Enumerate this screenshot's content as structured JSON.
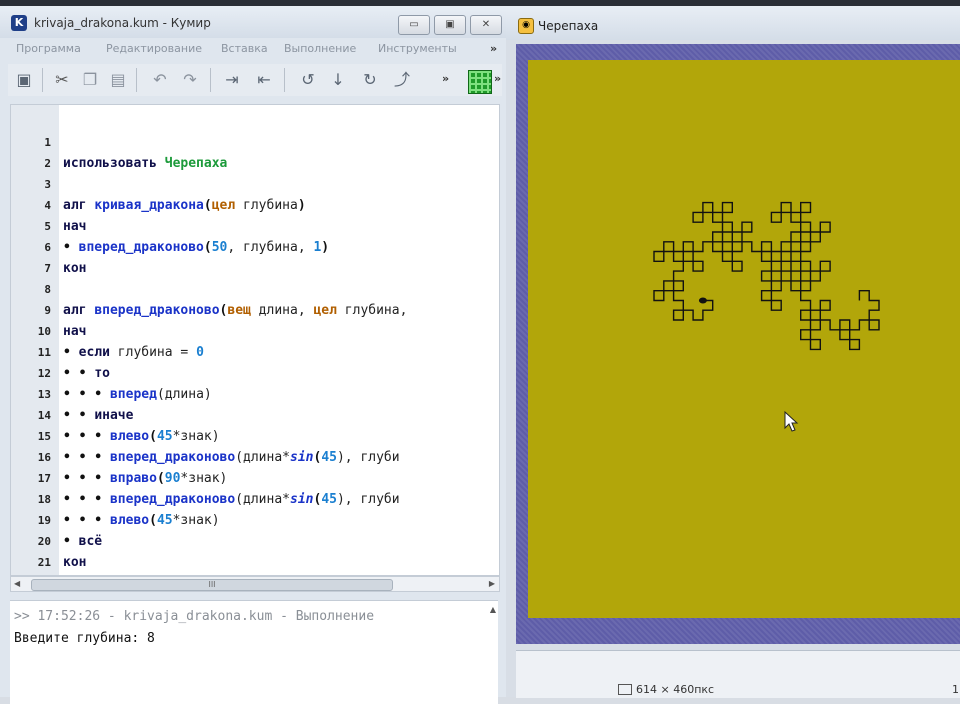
{
  "editor": {
    "title": "krivaja_drakona.kum - Кумир",
    "app_icon_letter": "K",
    "window_buttons": [
      "▭",
      "▣",
      "✕"
    ],
    "menu": [
      "Программа",
      "Редактирование",
      "Вставка",
      "Выполнение",
      "Инструменты"
    ],
    "menu_more": "»",
    "toolbar_more": "»",
    "toolbar_icons": [
      "save-icon",
      "cut-icon",
      "copy-icon",
      "paste-icon",
      "undo-icon",
      "redo-icon",
      "indent-icon",
      "unindent-icon",
      "step-over-icon",
      "step-into-icon",
      "step-out-icon",
      "run-to-end-icon",
      "grid-icon"
    ],
    "scroll_thumb_label": "III",
    "lines": [
      {
        "n": "1"
      },
      {
        "n": "2"
      },
      {
        "n": "3"
      },
      {
        "n": "4"
      },
      {
        "n": "5"
      },
      {
        "n": "6"
      },
      {
        "n": "7"
      },
      {
        "n": "8"
      },
      {
        "n": "9"
      },
      {
        "n": "10"
      },
      {
        "n": "11"
      },
      {
        "n": "12"
      },
      {
        "n": "13"
      },
      {
        "n": "14"
      },
      {
        "n": "15"
      },
      {
        "n": "16"
      },
      {
        "n": "17"
      },
      {
        "n": "18"
      },
      {
        "n": "19"
      },
      {
        "n": "20"
      },
      {
        "n": "21"
      }
    ],
    "code": {
      "l1_kw": "использовать ",
      "l1_mod": "Черепаха",
      "l3_kw": "алг ",
      "l3_fn": "кривая_дракона",
      "l3_p1": "(",
      "l3_type": "цел",
      "l3_var": " глубина",
      "l3_p2": ")",
      "l4_kw": "нач",
      "l5_dot": "• ",
      "l5_fn": "вперед_драконово",
      "l5_p1": "(",
      "l5_n1": "50",
      "l5_mid": ", глубина, ",
      "l5_n2": "1",
      "l5_p2": ")",
      "l6_kw": "кон",
      "l8_kw": "алг ",
      "l8_fn": "вперед_драконово",
      "l8_p1": "(",
      "l8_t1": "вещ",
      "l8_v1": " длина, ",
      "l8_t2": "цел",
      "l8_v2": " глубина,",
      "l9_kw": "нач",
      "l10_dot": "• ",
      "l10_kw": "если",
      "l10_var": " глубина = ",
      "l10_num": "0",
      "l11_dot": "• • ",
      "l11_kw": "то",
      "l12_dot": "• • • ",
      "l12_fn": "вперед",
      "l12_rest": "(длина)",
      "l13_dot": "• • ",
      "l13_kw": "иначе",
      "l14_dot": "• • • ",
      "l14_fn": "влево",
      "l14_p1": "(",
      "l14_num": "45",
      "l14_rest": "*знак)",
      "l15_dot": "• • • ",
      "l15_fn": "вперед_драконово",
      "l15_a": "(длина*",
      "l15_sin": "sin",
      "l15_b": "(",
      "l15_num": "45",
      "l15_c": "), глуби",
      "l16_dot": "• • • ",
      "l16_fn": "вправо",
      "l16_p1": "(",
      "l16_num": "90",
      "l16_rest": "*знак)",
      "l17_dot": "• • • ",
      "l17_fn": "вперед_драконово",
      "l17_a": "(длина*",
      "l17_sin": "sin",
      "l17_b": "(",
      "l17_num": "45",
      "l17_c": "), глуби",
      "l18_dot": "• • • ",
      "l18_fn": "влево",
      "l18_p1": "(",
      "l18_num": "45",
      "l18_rest": "*знак)",
      "l19_dot": "• ",
      "l19_kw": "всё",
      "l20_kw": "кон"
    },
    "console": {
      "line1": ">> 17:52:26 - krivaja_drakona.kum - Выполнение",
      "line2": "Введите глубина: 8"
    }
  },
  "turtle": {
    "title": "Черепаха",
    "status_size": "614 × 460пкс",
    "status_right": "1",
    "colors": {
      "canvas": "#b2a60a",
      "frame": "#5e5da8",
      "line": "#111111"
    },
    "dragon_depth": 8
  }
}
